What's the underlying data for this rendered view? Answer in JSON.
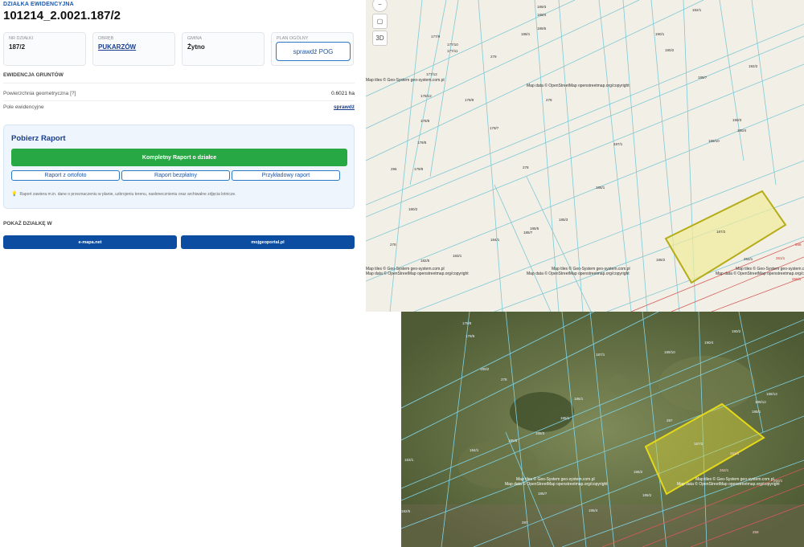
{
  "header": {
    "caption": "DZIAŁKA EWIDENCYJNA",
    "title": "101214_2.0021.187/2"
  },
  "cards": [
    {
      "label": "NR DZIAŁKI",
      "value": "187/2"
    },
    {
      "label": "OBRĘB",
      "value": "PUKARZÓW"
    },
    {
      "label": "GMINA",
      "value": "Żytno"
    },
    {
      "label": "PLAN OGÓLNY",
      "button": "sprawdź POG"
    }
  ],
  "ewidencja": {
    "title": "EWIDENCJA GRUNTÓW",
    "rows": [
      {
        "label": "Powierzchnia geometryczna [?]",
        "value": "0.6021 ha"
      },
      {
        "label": "Pole ewidencyjne",
        "value": "sprawdź"
      }
    ]
  },
  "raport": {
    "title": "Pobierz Raport",
    "main_button": "Kompletny Raport o działce",
    "buttons": [
      "Raport z ortofoto",
      "Raport bezpłatny",
      "Przykładowy raport"
    ],
    "note": "Raport zawiera m.in. dane o przeznaczeniu w planie, uzbrojeniu terenu, nasłonecznieniu oraz archiwalne zdjęcia lotnicze."
  },
  "pokaz": {
    "title": "POKAŻ DZIAŁKĘ W",
    "buttons": [
      "e-mapa.net",
      "mojgeoportal.pl"
    ]
  },
  "map_controls": {
    "zoom_out_icon": "minus-circle-icon",
    "layers_icon": "layers-icon",
    "mode_3d": "3D"
  },
  "attribution": {
    "line1": "Map tiles © Geo-System geo-system.com.pl",
    "line2": "Map data © OpenStreetMap openstreetmap.org/copyright"
  },
  "map_labels": {
    "top": [
      "189/3",
      "189/4",
      "189/5",
      "188/1",
      "177/9",
      "177/10",
      "177/11",
      "177/12",
      "179/8",
      "178/12",
      "178/9",
      "178/8",
      "179/9",
      "179/7",
      "180/2",
      "182/5",
      "183/1",
      "184/1",
      "185/3",
      "185/5",
      "185/7",
      "186/1",
      "186/2",
      "187/1",
      "187/2",
      "188/1",
      "189/7",
      "189/10",
      "189/11",
      "189/12",
      "189/13",
      "190/1",
      "190/2",
      "190/3",
      "190/4",
      "190/7",
      "192/1",
      "192/2",
      "193/4",
      "193/6",
      "279",
      "278",
      "296",
      "262/1",
      "260/1",
      "261/1",
      "258",
      "256"
    ],
    "bottom": [
      "179/9",
      "179/8",
      "180/2",
      "187/1",
      "186/1",
      "185/1",
      "185/3",
      "185/5",
      "184/1",
      "183/1",
      "182/5",
      "187/2",
      "190/2",
      "190/4",
      "189/10",
      "189/12",
      "189/13",
      "188/1",
      "186/2",
      "185/4",
      "185/2",
      "185/7",
      "278",
      "279",
      "287",
      "261/1",
      "260/1",
      "262/1",
      "259"
    ]
  },
  "colors": {
    "accent": "#1a56a8",
    "green": "#28a745",
    "navy": "#0d4da1",
    "parcel": "#c8c21a",
    "map_bg": "#f2efe6",
    "ortho_bg": "#5c6a3e"
  }
}
